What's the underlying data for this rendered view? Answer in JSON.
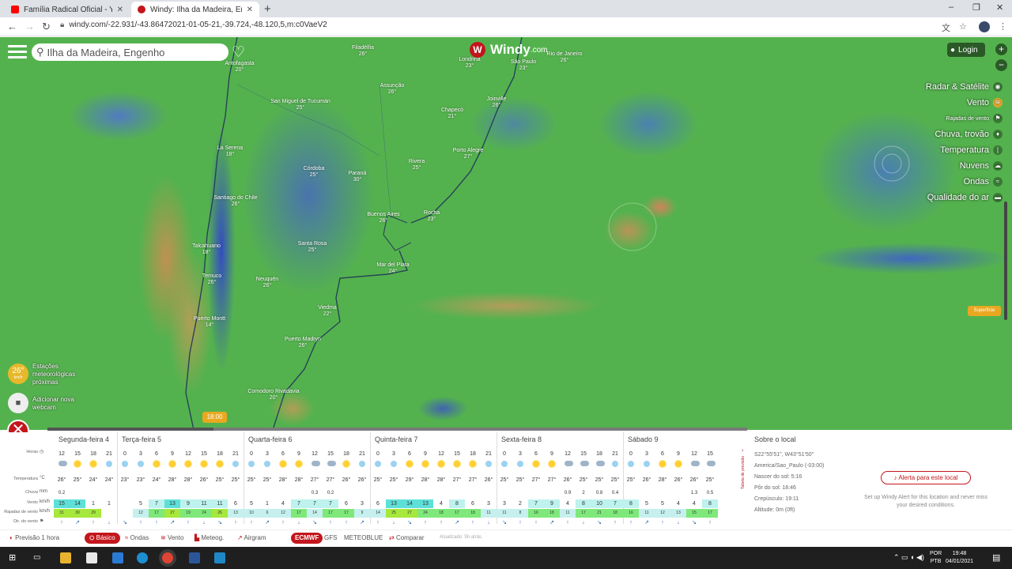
{
  "browser": {
    "tabs": [
      {
        "title": "Família Radical Oficial - YouTube",
        "color": "#ff0000"
      },
      {
        "title": "Windy: Ilha da Madeira, Engenho",
        "color": "#c4141c"
      }
    ],
    "url": "windy.com/-22.931/-43.86472021-01-05-21,-39.724,-48.120,5,m:c0VaeV2"
  },
  "search": {
    "value": "Ilha da Madeira, Engenho"
  },
  "logo": {
    "name": "Windy",
    "suffix": ".com",
    "accent": "#c4141c"
  },
  "login": "Login",
  "layers": [
    {
      "label": "Radar & Satélite",
      "icon": "radar-icon",
      "small": false,
      "sel": false
    },
    {
      "label": "Vento",
      "icon": "wind-icon",
      "small": false,
      "sel": true
    },
    {
      "label": "Rajadas de vento",
      "icon": "flag-icon",
      "small": true,
      "sel": false
    },
    {
      "label": "Chuva, trovão",
      "icon": "rain-icon",
      "small": false,
      "sel": false
    },
    {
      "label": "Temperatura",
      "icon": "thermometer-icon",
      "small": false,
      "sel": false
    },
    {
      "label": "Nuvens",
      "icon": "cloud-icon",
      "small": false,
      "sel": false
    },
    {
      "label": "Ondas",
      "icon": "waves-icon",
      "small": false,
      "sel": false
    },
    {
      "label": "Qualidade do ar",
      "icon": "air-icon",
      "small": false,
      "sel": false
    }
  ],
  "surface": "Superfície",
  "stations": {
    "temp": "26°",
    "unit": "km/h",
    "label1": "Estações",
    "label2": "meteorológicas",
    "label3": "próximas"
  },
  "webcam": {
    "label1": "Adicionar nova",
    "label2": "webcam"
  },
  "time_bubble": "18:00",
  "cities": [
    {
      "n": "Filadélfia",
      "t": "26°"
    },
    {
      "n": "Antofagasta",
      "t": "20°"
    },
    {
      "n": "Assunção",
      "t": "26°"
    },
    {
      "n": "San Miguel de Tucumán",
      "t": "25°"
    },
    {
      "n": "La Serena",
      "t": "18°"
    },
    {
      "n": "Córdoba",
      "t": "25°"
    },
    {
      "n": "Paraná",
      "t": "30°"
    },
    {
      "n": "Santiago do Chile",
      "t": "26°"
    },
    {
      "n": "Rivera",
      "t": "25°"
    },
    {
      "n": "Buenos Aires",
      "t": "26°"
    },
    {
      "n": "Rocha",
      "t": "23°"
    },
    {
      "n": "Temuco",
      "t": "26°"
    },
    {
      "n": "Talcahuano",
      "t": "18°"
    },
    {
      "n": "Santa Rosa",
      "t": "25°"
    },
    {
      "n": "Neuquén",
      "t": "26°"
    },
    {
      "n": "Mar del Plata",
      "t": "24°"
    },
    {
      "n": "Puerto Montt",
      "t": "14°"
    },
    {
      "n": "Viedma",
      "t": "22°"
    },
    {
      "n": "Puerto Madryn",
      "t": "26°"
    },
    {
      "n": "Comodoro Rivadavia",
      "t": "20°"
    },
    {
      "n": "Londrina",
      "t": "23°"
    },
    {
      "n": "São Paulo",
      "t": "23°"
    },
    {
      "n": "Rio de Janeiro",
      "t": "26°"
    },
    {
      "n": "Joinville",
      "t": "26°"
    },
    {
      "n": "Chapecó",
      "t": "21°"
    },
    {
      "n": "Porto Alegre",
      "t": "27°"
    }
  ],
  "forecast": {
    "days": [
      "Segunda-feira 4",
      "Terça-feira 5",
      "Quarta-feira 6",
      "Quinta-feira 7",
      "Sexta-feira 8",
      "Sábado 9"
    ],
    "row_labels": {
      "hours": "Horas",
      "temp": "Temperatura",
      "rain": "Chuva",
      "wind": "Vento",
      "gust": "Rajadas de vento",
      "dir": "Dir. do vento"
    },
    "units": {
      "temp": "°C",
      "rain": "mm",
      "wind": "km/h",
      "gust": "km/h"
    },
    "hours": [
      "12",
      "15",
      "18",
      "21",
      "0",
      "3",
      "6",
      "9",
      "12",
      "15",
      "18",
      "21",
      "0",
      "3",
      "6",
      "9",
      "12",
      "15",
      "18",
      "21",
      "0",
      "3",
      "6",
      "9",
      "12",
      "15",
      "18",
      "21",
      "0",
      "3",
      "6",
      "9",
      "12",
      "15",
      "18",
      "21",
      "0",
      "3",
      "6",
      "9",
      "12",
      "15"
    ],
    "temps": [
      "26°",
      "25°",
      "24°",
      "24°",
      "23°",
      "23°",
      "24°",
      "28°",
      "28°",
      "26°",
      "25°",
      "25°",
      "25°",
      "25°",
      "28°",
      "28°",
      "27°",
      "27°",
      "26°",
      "26°",
      "25°",
      "25°",
      "29°",
      "28°",
      "28°",
      "27°",
      "27°",
      "26°",
      "25°",
      "25°",
      "27°",
      "27°",
      "26°",
      "25°",
      "25°",
      "25°",
      "25°",
      "26°",
      "28°",
      "26°",
      "26°",
      "25°"
    ],
    "rain": [
      "0.2",
      "",
      "",
      "",
      "",
      "",
      "",
      "",
      "",
      "",
      "",
      "",
      "",
      "",
      "",
      "",
      "0.3",
      "0.2",
      "",
      "",
      "",
      "",
      "",
      "",
      "",
      "",
      "",
      "",
      "",
      "",
      "",
      "",
      "0.9",
      "2",
      "0.8",
      "0.4",
      "",
      "",
      "",
      "",
      "1.3",
      "0.5"
    ],
    "wind": [
      "15",
      "14",
      "1",
      "1",
      "",
      "5",
      "7",
      "13",
      "9",
      "11",
      "11",
      "6",
      "5",
      "1",
      "4",
      "7",
      "7",
      "7",
      "6",
      "3",
      "6",
      "13",
      "14",
      "13",
      "4",
      "8",
      "6",
      "3",
      "3",
      "2",
      "7",
      "9",
      "4",
      "8",
      "10",
      "7",
      "8",
      "5",
      "5",
      "4",
      "4",
      "8"
    ],
    "gust": [
      "31",
      "30",
      "29",
      "",
      "",
      "12",
      "17",
      "27",
      "19",
      "24",
      "26",
      "13",
      "10",
      "6",
      "12",
      "17",
      "14",
      "17",
      "17",
      "9",
      "14",
      "25",
      "27",
      "24",
      "18",
      "17",
      "18",
      "11",
      "11",
      "8",
      "16",
      "18",
      "11",
      "17",
      "21",
      "18",
      "16",
      "11",
      "12",
      "13",
      "15",
      "17"
    ]
  },
  "about": {
    "title": "Sobre o local",
    "coords": "S22°55'51\", W43°51'50\"",
    "tz": "America/Sao_Paulo (-03:00)",
    "sunrise": "Nascer do sol: 5:16",
    "sunset": "Pôr do sol: 18:46",
    "dusk": "Crepúsculo: 19:11",
    "alt": "Altitude: 0m (0ft)",
    "alert": "Alerta para este local",
    "alert_sub": "Set up Windy Alert for this location and never miss your desired conditions.",
    "side": "Tabela de previsão"
  },
  "bottom": {
    "preview": "Previsão 1 hora",
    "basic": "Básico",
    "waves": "Ondas",
    "wind": "Vento",
    "meteo": "Meteog.",
    "airgram": "Airgram",
    "ecmwf": "ECMWF",
    "gfs": "GFS",
    "meteoblue": "METEOBLUE",
    "compare": "Comparar",
    "updated": "Atualizado: 5h atrás"
  },
  "taskbar": {
    "lang": "POR",
    "layout": "PTB",
    "time": "19:48",
    "date": "04/01/2021"
  }
}
